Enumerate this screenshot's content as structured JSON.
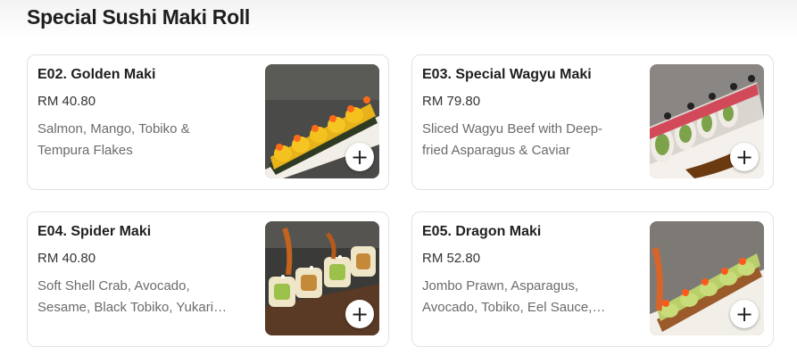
{
  "section": {
    "title": "Special Sushi Maki Roll"
  },
  "items": [
    {
      "name": "E02. Golden Maki",
      "price": "RM 40.80",
      "description": "Salmon, Mango, Tobiko & Tempura Flakes",
      "image_icon": "golden-maki-image",
      "add_icon": "+"
    },
    {
      "name": "E03. Special Wagyu Maki",
      "price": "RM 79.80",
      "description": "Sliced Wagyu Beef with Deep-fried Asparagus & Caviar",
      "image_icon": "wagyu-maki-image",
      "add_icon": "+"
    },
    {
      "name": "E04. Spider Maki",
      "price": "RM 40.80",
      "description": "Soft Shell Crab, Avocado, Sesame, Black Tobiko, Yukari Furikake",
      "image_icon": "spider-maki-image",
      "add_icon": "+"
    },
    {
      "name": "E05. Dragon Maki",
      "price": "RM 52.80",
      "description": "Jombo Prawn, Asparagus, Avocado, Tobiko, Eel Sauce, Mayo",
      "image_icon": "dragon-maki-image",
      "add_icon": "+"
    }
  ],
  "colors": {
    "card_border": "#e2e2e2",
    "text_primary": "#1f1f1f",
    "text_muted": "#6b6b6b"
  }
}
